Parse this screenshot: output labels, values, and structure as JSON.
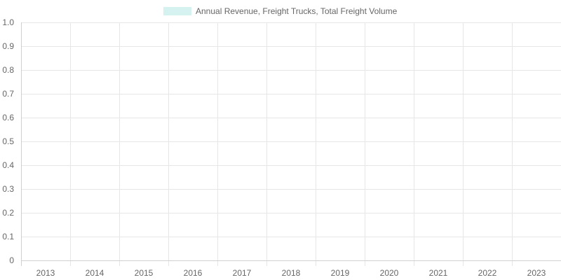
{
  "chart_data": {
    "type": "bar",
    "categories": [
      "2013",
      "2014",
      "2015",
      "2016",
      "2017",
      "2018",
      "2019",
      "2020",
      "2021",
      "2022",
      "2023"
    ],
    "series": [
      {
        "name": "Annual Revenue, Freight Trucks, Total Freight Volume",
        "values": [
          null,
          null,
          null,
          null,
          null,
          null,
          null,
          null,
          null,
          null,
          null
        ],
        "color": "#d6f2f0"
      }
    ],
    "y_ticks": [
      "0",
      "0.1",
      "0.2",
      "0.3",
      "0.4",
      "0.5",
      "0.6",
      "0.7",
      "0.8",
      "0.9",
      "1.0"
    ],
    "ylim": [
      0,
      1
    ],
    "grid": true,
    "legend_position": "top-center",
    "colors": {
      "grid": "#e6e6e6",
      "axis": "#d0d0d0",
      "text": "#666666",
      "legend_swatch": "#d6f2f0"
    }
  }
}
